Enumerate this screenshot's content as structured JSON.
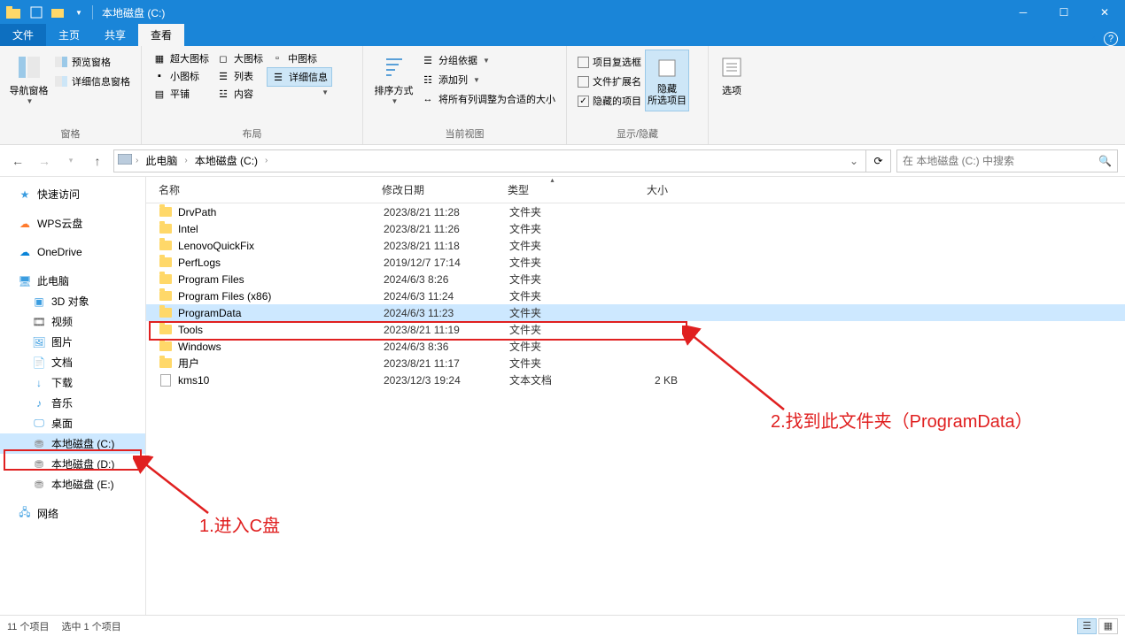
{
  "title": "本地磁盘 (C:)",
  "tabs": {
    "file": "文件",
    "home": "主页",
    "share": "共享",
    "view": "查看"
  },
  "ribbon": {
    "panes": {
      "label": "窗格",
      "nav": "导航窗格",
      "preview": "预览窗格",
      "details": "详细信息窗格"
    },
    "layout": {
      "label": "布局",
      "xl": "超大图标",
      "lg": "大图标",
      "md": "中图标",
      "sm": "小图标",
      "list": "列表",
      "detail": "详细信息",
      "tiles": "平铺",
      "content": "内容"
    },
    "current": {
      "label": "当前视图",
      "sort": "排序方式",
      "group": "分组依据",
      "addcol": "添加列",
      "fitcols": "将所有列调整为合适的大小"
    },
    "showhide": {
      "label": "显示/隐藏",
      "itemchk": "项目复选框",
      "ext": "文件扩展名",
      "hidden": "隐藏的项目",
      "hidesel": "隐藏\n所选项目"
    },
    "options": "选项"
  },
  "breadcrumb": {
    "pc": "此电脑",
    "drive": "本地磁盘 (C:)"
  },
  "search_placeholder": "在 本地磁盘 (C:) 中搜索",
  "columns": {
    "name": "名称",
    "date": "修改日期",
    "type": "类型",
    "size": "大小"
  },
  "sidebar": {
    "quick": "快速访问",
    "wps": "WPS云盘",
    "onedrive": "OneDrive",
    "pc": "此电脑",
    "obj3d": "3D 对象",
    "video": "视频",
    "pics": "图片",
    "docs": "文档",
    "downloads": "下载",
    "music": "音乐",
    "desktop": "桌面",
    "c": "本地磁盘 (C:)",
    "d": "本地磁盘 (D:)",
    "e": "本地磁盘 (E:)",
    "network": "网络"
  },
  "rows": [
    {
      "name": "DrvPath",
      "date": "2023/8/21 11:28",
      "type": "文件夹",
      "size": "",
      "icon": "folder"
    },
    {
      "name": "Intel",
      "date": "2023/8/21 11:26",
      "type": "文件夹",
      "size": "",
      "icon": "folder"
    },
    {
      "name": "LenovoQuickFix",
      "date": "2023/8/21 11:18",
      "type": "文件夹",
      "size": "",
      "icon": "folder"
    },
    {
      "name": "PerfLogs",
      "date": "2019/12/7 17:14",
      "type": "文件夹",
      "size": "",
      "icon": "folder"
    },
    {
      "name": "Program Files",
      "date": "2024/6/3 8:26",
      "type": "文件夹",
      "size": "",
      "icon": "folder"
    },
    {
      "name": "Program Files (x86)",
      "date": "2024/6/3 11:24",
      "type": "文件夹",
      "size": "",
      "icon": "folder"
    },
    {
      "name": "ProgramData",
      "date": "2024/6/3 11:23",
      "type": "文件夹",
      "size": "",
      "icon": "folder",
      "selected": true
    },
    {
      "name": "Tools",
      "date": "2023/8/21 11:19",
      "type": "文件夹",
      "size": "",
      "icon": "folder"
    },
    {
      "name": "Windows",
      "date": "2024/6/3 8:36",
      "type": "文件夹",
      "size": "",
      "icon": "folder"
    },
    {
      "name": "用户",
      "date": "2023/8/21 11:17",
      "type": "文件夹",
      "size": "",
      "icon": "folder"
    },
    {
      "name": "kms10",
      "date": "2023/12/3 19:24",
      "type": "文本文档",
      "size": "2 KB",
      "icon": "file"
    }
  ],
  "status": {
    "count": "11 个项目",
    "sel": "选中 1 个项目"
  },
  "annotations": {
    "step1": "1.进入C盘",
    "step2": "2.找到此文件夹（ProgramData）"
  }
}
